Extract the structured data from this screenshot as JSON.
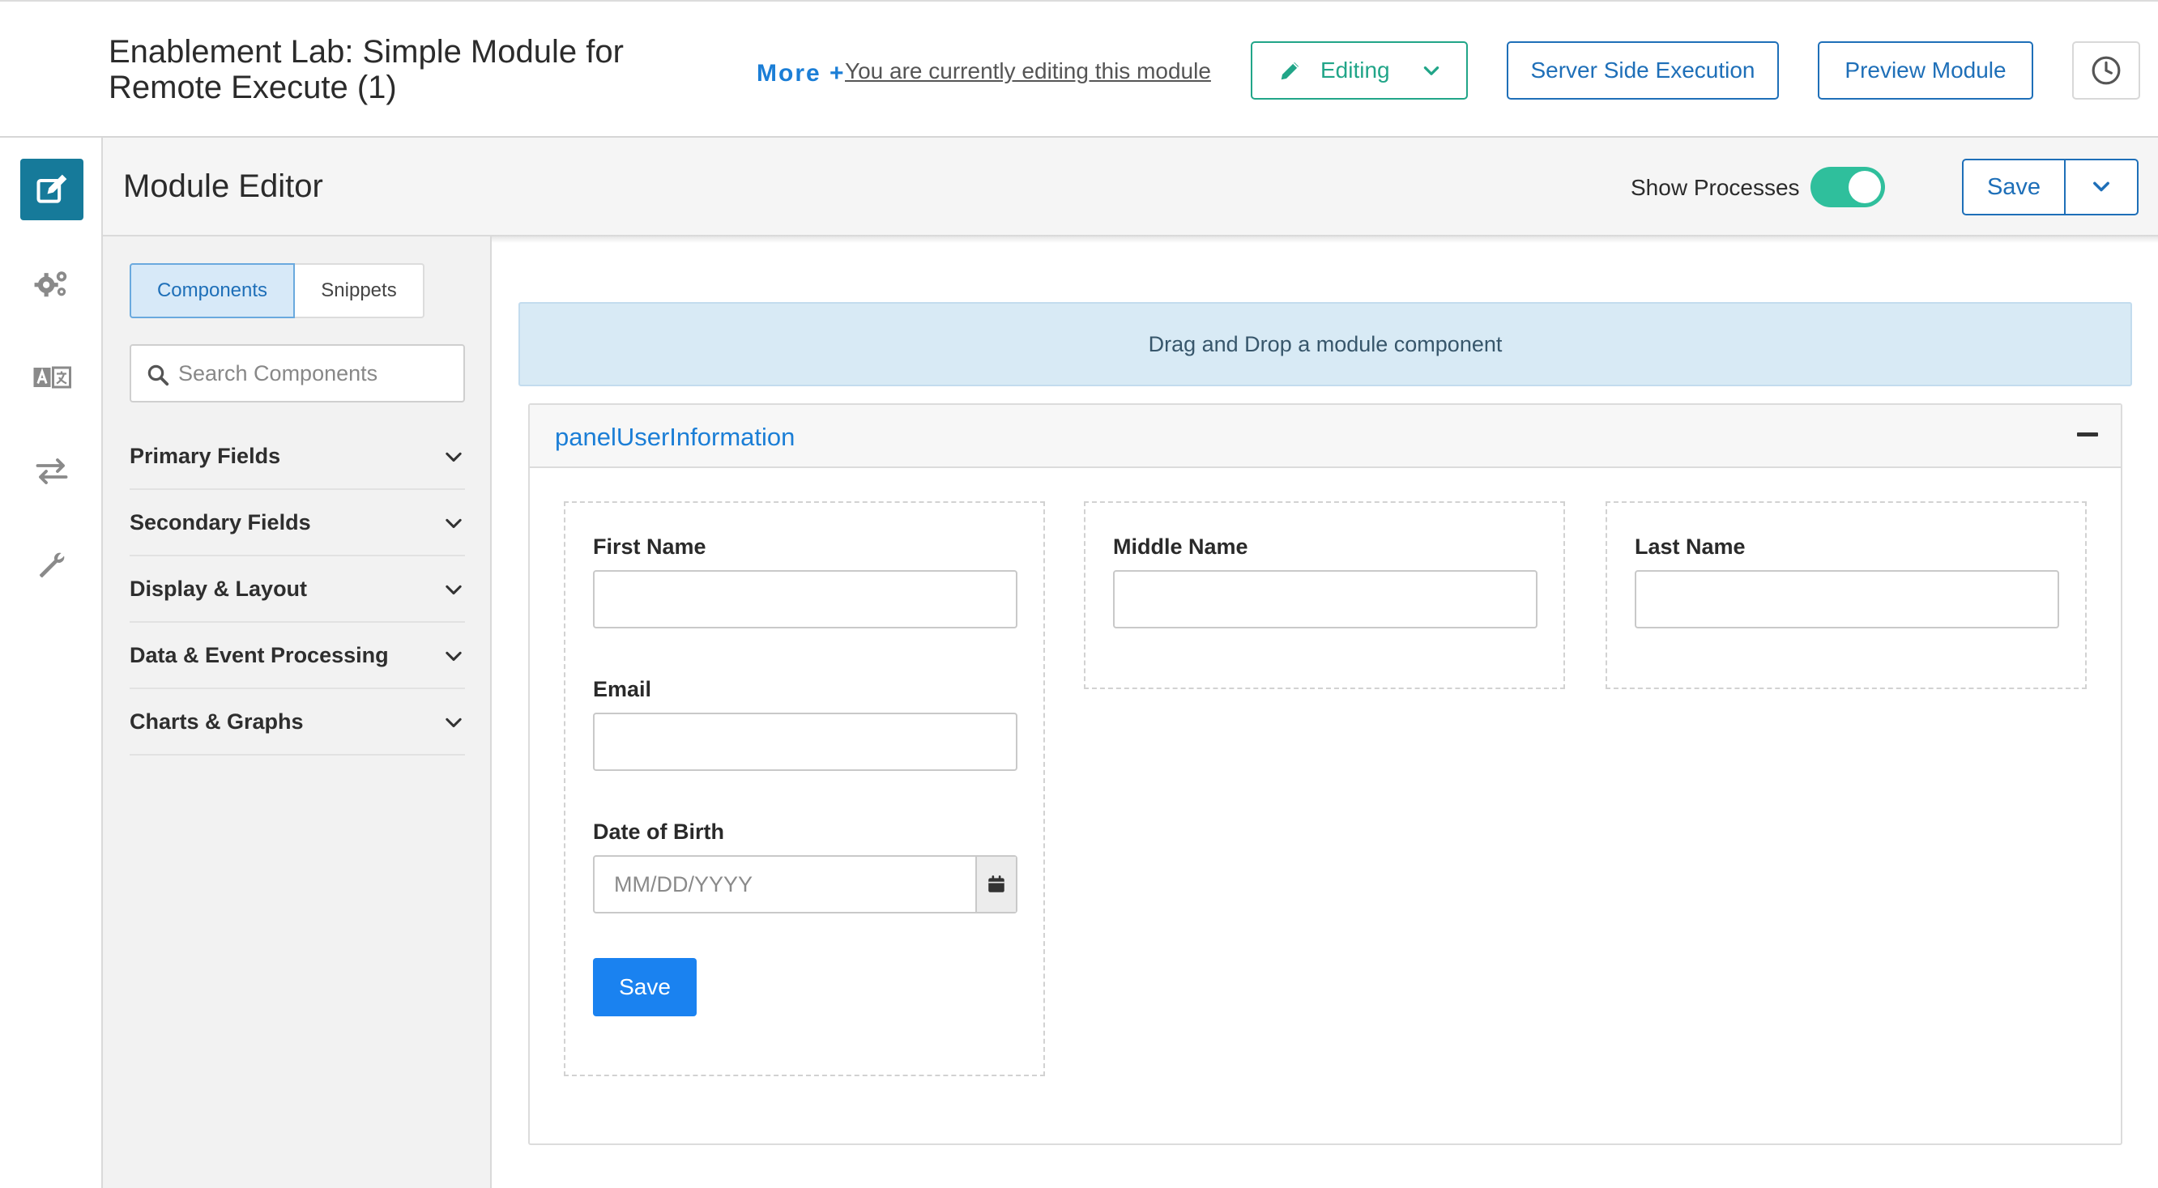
{
  "header": {
    "app_title": "Enablement Lab: Simple Module for Remote Execute (1)",
    "more_label": "More +",
    "editing_note": "You are currently editing this module",
    "editing_button": "Editing",
    "server_side_button": "Server Side Execution",
    "preview_button": "Preview Module",
    "history_icon": "clock-icon"
  },
  "rail": {
    "items": [
      {
        "icon": "edit-icon",
        "active": true
      },
      {
        "icon": "gears-icon",
        "active": false
      },
      {
        "icon": "translate-icon",
        "active": false
      },
      {
        "icon": "arrows-exchange-icon",
        "active": false
      },
      {
        "icon": "wrench-icon",
        "active": false
      }
    ]
  },
  "editor": {
    "title": "Module Editor",
    "show_processes_label": "Show Processes",
    "show_processes_on": true,
    "save_label": "Save"
  },
  "sidebar": {
    "tabs": [
      "Components",
      "Snippets"
    ],
    "active_tab": "Components",
    "search_placeholder": "Search Components",
    "sections": [
      "Primary Fields",
      "Secondary Fields",
      "Display & Layout",
      "Data & Event Processing",
      "Charts & Graphs"
    ]
  },
  "canvas": {
    "dropzone_text": "Drag and Drop a module component",
    "panel_title": "panelUserInformation",
    "fields": {
      "first_name_label": "First Name",
      "first_name_value": "",
      "middle_name_label": "Middle Name",
      "middle_name_value": "",
      "last_name_label": "Last Name",
      "last_name_value": "",
      "email_label": "Email",
      "email_value": "",
      "dob_label": "Date of Birth",
      "dob_placeholder": "MM/DD/YYYY"
    },
    "save_button": "Save"
  },
  "colors": {
    "brand_blue": "#1e6fb8",
    "link_blue": "#1b7ed6",
    "editing_green": "#21a588",
    "toggle_green": "#2fbf9c",
    "rail_active": "#167a9a",
    "primary_button": "#1a82f0",
    "dropzone_bg": "#d8eaf5"
  }
}
